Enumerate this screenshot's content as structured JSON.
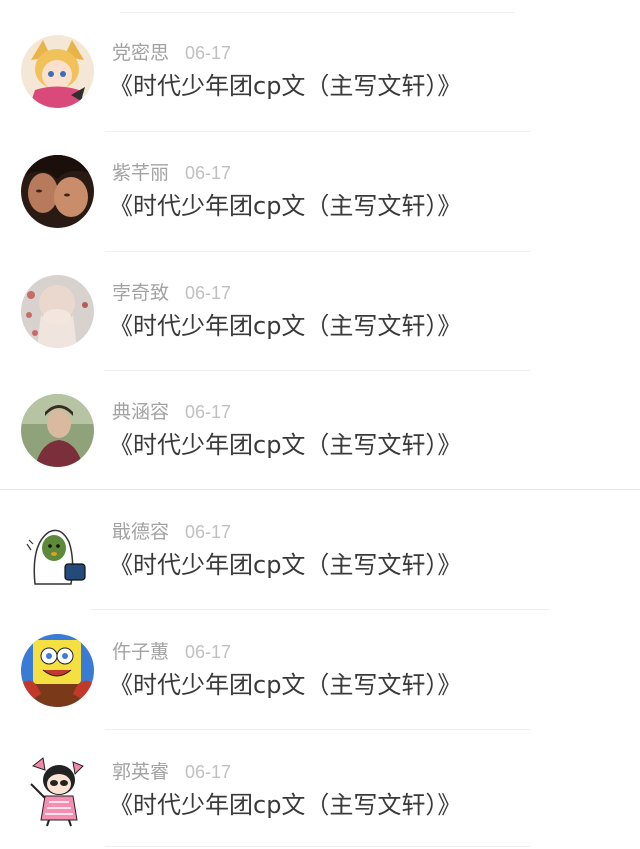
{
  "comments": [
    {
      "name": "党密思",
      "date": "06-17",
      "title": "《时代少年团cp文（主写文轩）》",
      "avatar": "anime-character-avatar"
    },
    {
      "name": "紫芊丽",
      "date": "06-17",
      "title": "《时代少年团cp文（主写文轩）》",
      "avatar": "two-faces-photo-avatar"
    },
    {
      "name": "孛奇致",
      "date": "06-17",
      "title": "《时代少年团cp文（主写文轩）》",
      "avatar": "girl-hands-photo-avatar"
    },
    {
      "name": "典涵容",
      "date": "06-17",
      "title": "《时代少年团cp文（主写文轩）》",
      "avatar": "young-man-photo-avatar"
    },
    {
      "name": "戢德容",
      "date": "06-17",
      "title": "《时代少年团cp文（主写文轩）》",
      "avatar": "green-cartoon-avatar"
    },
    {
      "name": "仵子蕙",
      "date": "06-17",
      "title": "《时代少年团cp文（主写文轩）》",
      "avatar": "spongebob-cartoon-avatar"
    },
    {
      "name": "郭英睿",
      "date": "06-17",
      "title": "《时代少年团cp文（主写文轩）》",
      "avatar": "cartoon-girl-avatar"
    }
  ]
}
